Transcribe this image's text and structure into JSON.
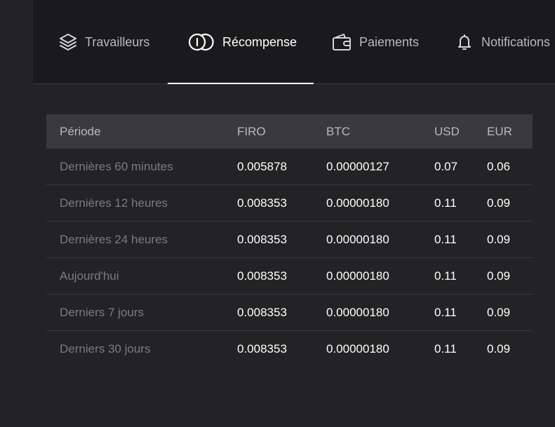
{
  "tabs": [
    {
      "label": "Travailleurs",
      "icon": "layers-icon",
      "active": false
    },
    {
      "label": "Récompense",
      "icon": "coin-icon",
      "active": true
    },
    {
      "label": "Paiements",
      "icon": "wallet-icon",
      "active": false
    },
    {
      "label": "Notifications",
      "icon": "bell-icon",
      "active": false
    }
  ],
  "colors": {
    "background": "#232325",
    "tabbar": "#1a1a1c",
    "header_row": "#3a3a3d",
    "active_text": "#ffffff",
    "inactive_text": "#b9b9bd",
    "period_text": "#7b7b80"
  },
  "table": {
    "headers": [
      "Période",
      "FIRO",
      "BTC",
      "USD",
      "EUR"
    ],
    "rows": [
      [
        "Dernières 60 minutes",
        "0.005878",
        "0.00000127",
        "0.07",
        "0.06"
      ],
      [
        "Dernières 12 heures",
        "0.008353",
        "0.00000180",
        "0.11",
        "0.09"
      ],
      [
        "Dernières 24 heures",
        "0.008353",
        "0.00000180",
        "0.11",
        "0.09"
      ],
      [
        "Aujourd'hui",
        "0.008353",
        "0.00000180",
        "0.11",
        "0.09"
      ],
      [
        "Derniers 7 jours",
        "0.008353",
        "0.00000180",
        "0.11",
        "0.09"
      ],
      [
        "Derniers 30 jours",
        "0.008353",
        "0.00000180",
        "0.11",
        "0.09"
      ]
    ]
  }
}
